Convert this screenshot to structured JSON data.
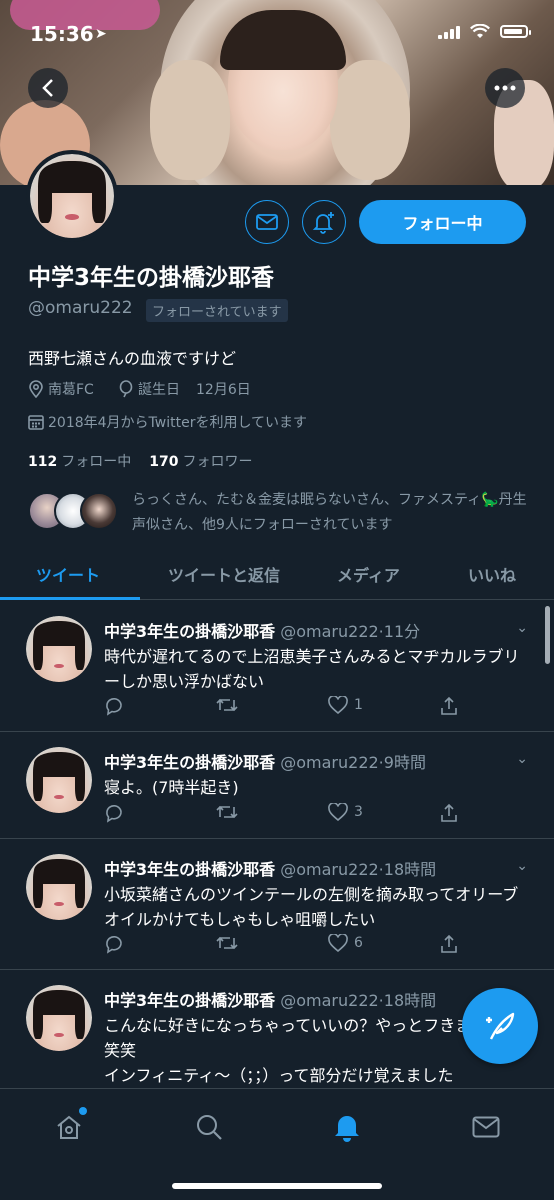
{
  "status_bar": {
    "time": "15:36"
  },
  "profile": {
    "name": "中学3年生の掛橋沙耶香",
    "handle": "@omaru222",
    "follows_you": "フォローされています",
    "bio": "西野七瀬さんの血液ですけど",
    "location": "南葛FC",
    "birthday_label": "誕生日",
    "birthday": "12月6日",
    "joined": "2018年4月からTwitterを利用しています",
    "following_count": "112",
    "following_label": "フォロー中",
    "followers_count": "170",
    "followers_label": "フォロワー",
    "followed_by": "らっくさん、たむ＆金麦は眠らないさん、ファメスティ🦕丹生声似さん、他9人にフォローされています",
    "follow_button": "フォロー中"
  },
  "tabs": [
    {
      "label": "ツイート",
      "active": true
    },
    {
      "label": "ツイートと返信",
      "active": false
    },
    {
      "label": "メディア",
      "active": false
    },
    {
      "label": "いいね",
      "active": false
    }
  ],
  "tweets": [
    {
      "name": "中学3年生の掛橋沙耶香",
      "handle": "@omaru222",
      "time": "11分",
      "text": "時代が遅れてるので上沼恵美子さんみるとマヂカルラブリーしか思い浮かばない",
      "likes": "1"
    },
    {
      "name": "中学3年生の掛橋沙耶香",
      "handle": "@omaru222",
      "time": "9時間",
      "text": "寝よ。(7時半起き)",
      "likes": "3"
    },
    {
      "name": "中学3年生の掛橋沙耶香",
      "handle": "@omaru222",
      "time": "18時間",
      "text": "小坂菜緒さんのツインテールの左側を摘み取ってオリーブオイルかけてもしゃもしゃ咀嚼したい",
      "likes": "6"
    },
    {
      "name": "中学3年生の掛橋沙耶香",
      "handle": "@omaru222",
      "time": "18時間",
      "text": "こんなに好きになっちゃっていいの？やっとフきました笑笑\nインフィニティ〜（；；）って部分だけ覚えました",
      "likes": ""
    }
  ],
  "colors": {
    "background": "#15202b",
    "accent": "#1d9bf0",
    "secondary_text": "#8899a6",
    "divider": "#38444d"
  },
  "icons": {
    "back": "chevron-left-icon",
    "more": "more-icon",
    "message": "envelope-icon",
    "notify": "bell-plus-icon",
    "location": "location-icon",
    "birthday": "balloon-icon",
    "calendar": "calendar-icon",
    "reply": "reply-icon",
    "retweet": "retweet-icon",
    "like": "heart-icon",
    "share": "share-icon",
    "compose": "compose-icon",
    "home": "home-icon",
    "search": "search-icon",
    "notifications": "bell-icon",
    "messages": "envelope-icon"
  }
}
